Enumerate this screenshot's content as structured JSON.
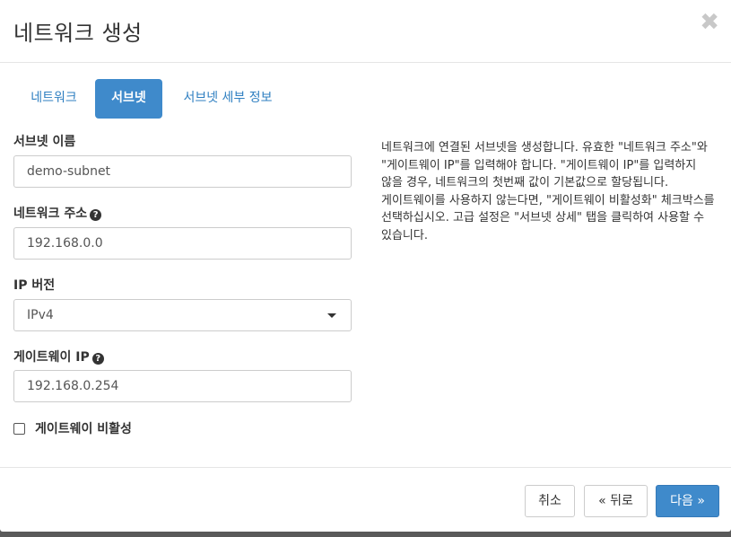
{
  "dialog": {
    "title": "네트워크 생성",
    "close_glyph": "✖"
  },
  "tabs": [
    {
      "label": "네트워크",
      "active": false
    },
    {
      "label": "서브넷",
      "active": true
    },
    {
      "label": "서브넷 세부 정보",
      "active": false
    }
  ],
  "form": {
    "subnet_name": {
      "label": "서브넷 이름",
      "value": "demo-subnet"
    },
    "network_address": {
      "label": "네트워크 주소",
      "value": "192.168.0.0",
      "help": "?"
    },
    "ip_version": {
      "label": "IP 버전",
      "value": "IPv4"
    },
    "gateway_ip": {
      "label": "게이트웨이 IP",
      "value": "192.168.0.254",
      "help": "?"
    },
    "disable_gateway": {
      "label": "게이트웨이 비활성",
      "checked": false
    }
  },
  "help_text": "네트워크에 연결된 서브넷을 생성합니다. 유효한 \"네트워크 주소\"와 \"게이트웨이 IP\"를 입력해야 합니다. \"게이트웨이 IP\"를 입력하지 않을 경우, 네트워크의 첫번째 값이 기본값으로 할당됩니다. 게이트웨이를 사용하지 않는다면, \"게이트웨이 비활성화\" 체크박스를 선택하십시오. 고급 설정은 \"서브넷 상세\" 탭을 클릭하여 사용할 수 있습니다.",
  "footer": {
    "cancel_label": "취소",
    "back_label": "« 뒤로",
    "next_label": "다음 »"
  },
  "colors": {
    "accent": "#3f8acb",
    "link": "#2f7fc1",
    "backdrop": "#5a5a5a"
  }
}
